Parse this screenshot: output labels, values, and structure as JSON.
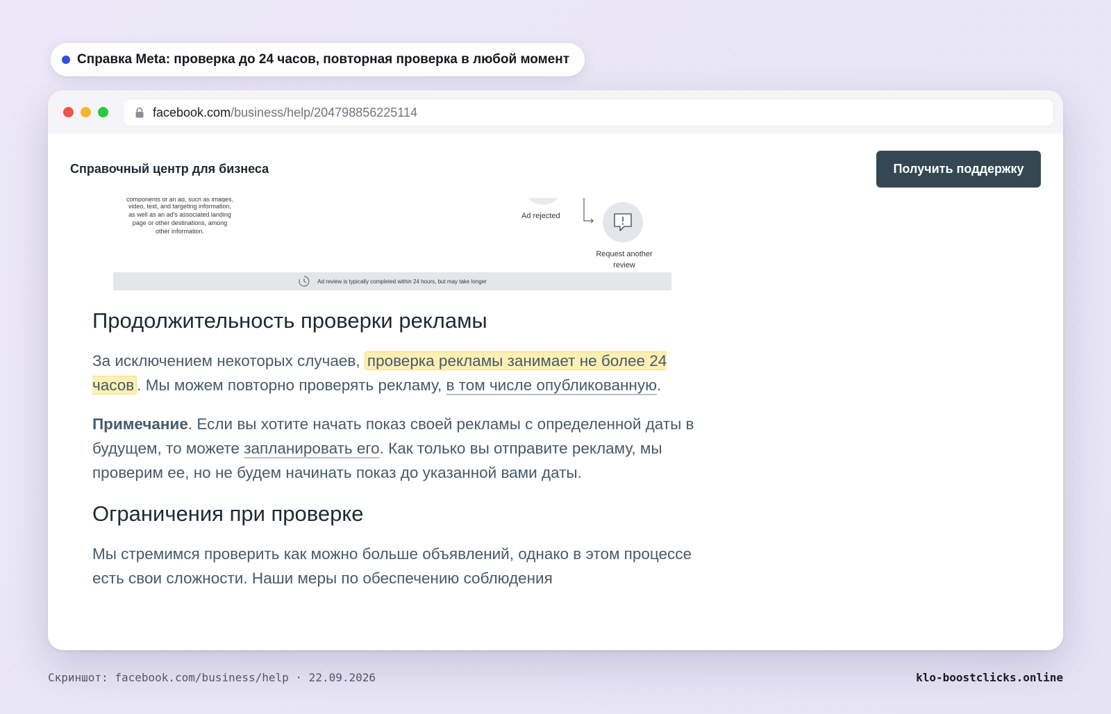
{
  "caption": {
    "text": "Справка Meta: проверка до 24 часов, повторная проверка в любой момент",
    "dot_color": "#2f4fd9"
  },
  "browser": {
    "url_domain": "facebook.com",
    "url_path": "/business/help/204798856225114",
    "lock_icon": "lock-icon"
  },
  "header": {
    "title": "Справочный центр для бизнеса",
    "support_button": "Получить поддержку",
    "support_button_color": "#344854"
  },
  "diagram": {
    "desc_line_partial": "components of an ad, such as images,",
    "desc_lines": [
      "video, text, and targeting information,",
      "as well as an ad's associated landing",
      "page or other destinations, among",
      "other information."
    ],
    "ad_rejected": "Ad rejected",
    "request_review_line1": "Request another",
    "request_review_line2": "review",
    "bar_text": "Ad review is typically completed within 24 hours, but may take longer"
  },
  "article": {
    "h_duration": "Продолжительность проверки рекламы",
    "p1_start": "За исключением некоторых случаев, ",
    "p1_highlight": "проверка рекламы занимает не более 24 часов",
    "p1_mid": ". Мы можем повторно проверять рекламу, ",
    "p1_link": "в том числе опубликованную",
    "p1_end": ".",
    "p2_bold": "Примечание",
    "p2_start": ". Если вы хотите начать показ своей рекламы с определенной даты в будущем, то можете ",
    "p2_link": "запланировать его",
    "p2_end": ". Как только вы отправите рекламу, мы проверим ее, но не будем начинать показ до указанной вами даты.",
    "h_limits": "Ограничения при проверке",
    "p3": "Мы стремимся проверить как можно больше объявлений, однако в этом процессе есть свои сложности. Наши меры по обеспечению соблюдения",
    "highlight_color": "#fdf0b4"
  },
  "footer": {
    "left": "Скриншот: facebook.com/business/help · 22.09.2026",
    "right": "klo-boostclicks.online"
  }
}
